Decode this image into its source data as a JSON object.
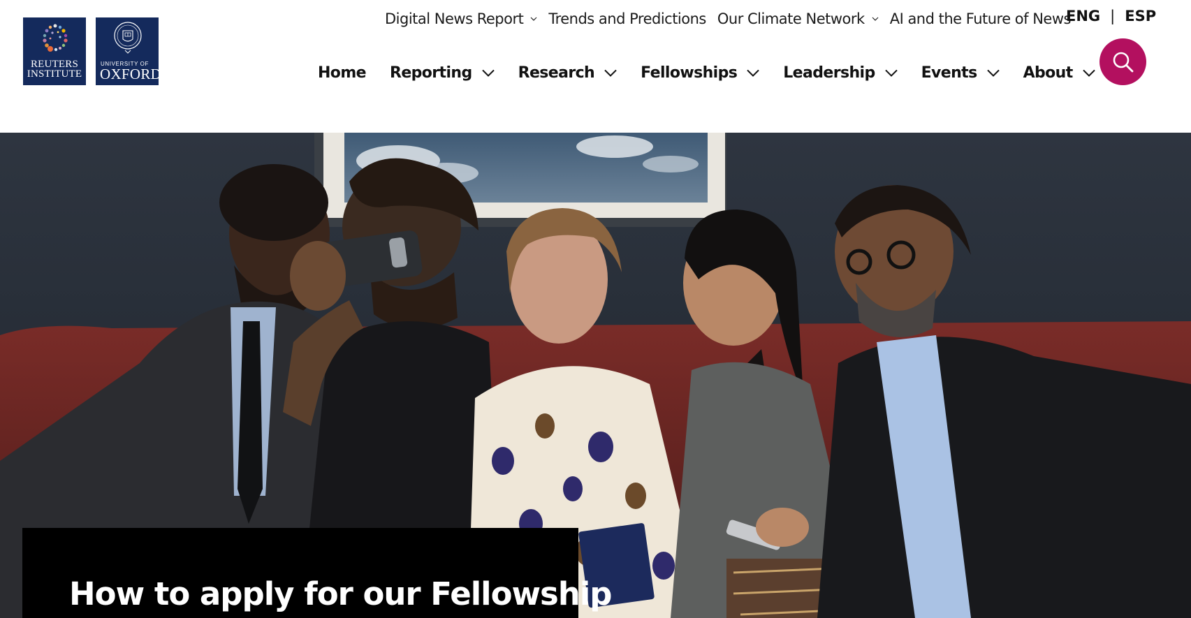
{
  "logos": {
    "reuters": {
      "line1": "REUTERS",
      "line2": "INSTITUTE"
    },
    "oxford": {
      "small": "UNIVERSITY OF",
      "big": "OXFORD"
    }
  },
  "top_links": [
    {
      "label": "Digital News Report",
      "has_dropdown": true
    },
    {
      "label": "Trends and Predictions",
      "has_dropdown": false
    },
    {
      "label": "Our Climate Network",
      "has_dropdown": true
    },
    {
      "label": "AI and the Future of News",
      "has_dropdown": false
    }
  ],
  "language": {
    "current": "ENG",
    "separator": "|",
    "other": "ESP"
  },
  "search": {
    "icon": "search-icon",
    "color": "#b3105f"
  },
  "main_nav": [
    {
      "label": "Home",
      "has_dropdown": false
    },
    {
      "label": "Reporting",
      "has_dropdown": true
    },
    {
      "label": "Research",
      "has_dropdown": true
    },
    {
      "label": "Fellowships",
      "has_dropdown": true
    },
    {
      "label": "Leadership",
      "has_dropdown": true
    },
    {
      "label": "Events",
      "has_dropdown": true
    },
    {
      "label": "About",
      "has_dropdown": true
    }
  ],
  "hero": {
    "title": "How to apply for our Fellowship"
  },
  "colors": {
    "logo_navy": "#142a5c",
    "accent_magenta": "#b3105f",
    "title_box": "#000000"
  }
}
